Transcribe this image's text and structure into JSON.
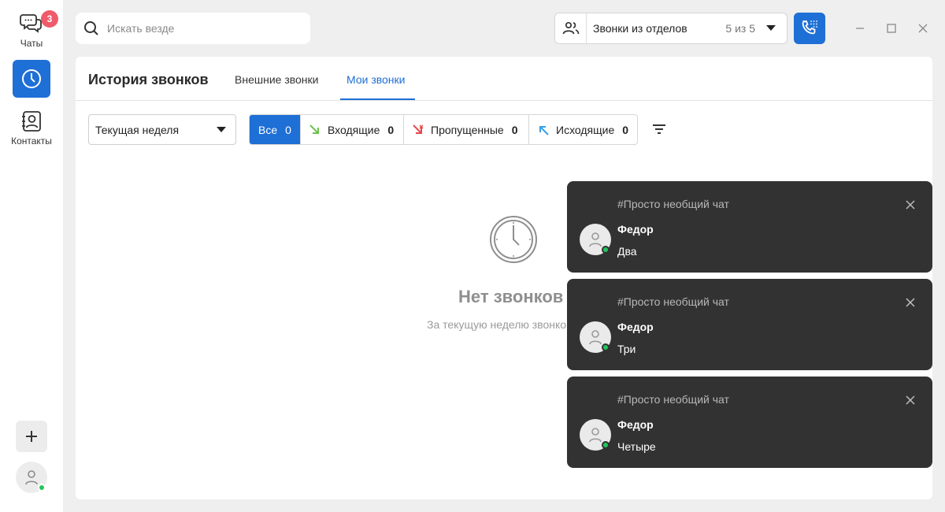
{
  "nav": {
    "chats_label": "Чаты",
    "chats_badge": "3",
    "contacts_label": "Контакты"
  },
  "search": {
    "placeholder": "Искать везде"
  },
  "dept_calls": {
    "label": "Звонки из отделов",
    "count": "5 из 5"
  },
  "panel": {
    "title": "История звонков",
    "tabs": [
      {
        "label": "Внешние звонки",
        "active": false
      },
      {
        "label": "Мои звонки",
        "active": true
      }
    ],
    "period": "Текущая неделя",
    "filters": [
      {
        "label": "Все",
        "count": "0",
        "active": true
      },
      {
        "label": "Входящие",
        "count": "0",
        "icon": "incoming-call-icon"
      },
      {
        "label": "Пропущенные",
        "count": "0",
        "icon": "missed-call-icon"
      },
      {
        "label": "Исходящие",
        "count": "0",
        "icon": "outgoing-call-icon"
      }
    ],
    "empty": {
      "title": "Нет звонков",
      "subtitle": "За текущую неделю звонко"
    }
  },
  "notifications": [
    {
      "chat": "#Просто необщий чат",
      "sender": "Федор",
      "message": "Два"
    },
    {
      "chat": "#Просто необщий чат",
      "sender": "Федор",
      "message": "Три"
    },
    {
      "chat": "#Просто необщий чат",
      "sender": "Федор",
      "message": "Четыре"
    }
  ],
  "colors": {
    "accent": "#1e6fd6",
    "badge": "#ef5b6a",
    "online": "#22c55e",
    "toast_bg": "#323232",
    "incoming": "#6cc24a",
    "missed": "#e5484d",
    "outgoing": "#3aa0e8"
  }
}
